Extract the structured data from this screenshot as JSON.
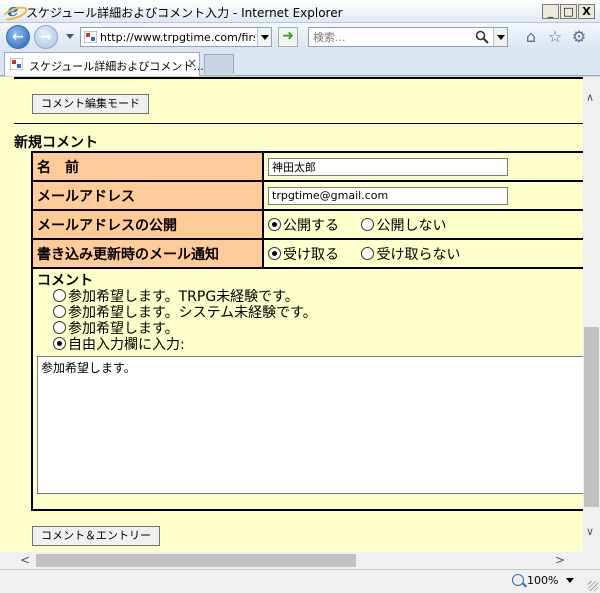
{
  "window": {
    "title": "スケジュール詳細およびコメント入力 - Internet Explorer",
    "minimize": "_",
    "maximize": "□",
    "close": "X"
  },
  "address_bar": {
    "url": "http://www.trpgtime.com/firs",
    "search_placeholder": "検索..."
  },
  "tab": {
    "label": "スケジュール詳細およびコメント...",
    "close": "×"
  },
  "page": {
    "edit_mode_button": "コメント編集モード",
    "section_title": "新規コメント",
    "name_label": "名　前",
    "name_value": "神田太郎",
    "email_label": "メールアドレス",
    "email_value": "trpgtime@gmail.com",
    "email_public_label": "メールアドレスの公開",
    "email_public_options": [
      "公開する",
      "公開しない"
    ],
    "email_public_selected": 0,
    "notify_label": "書き込み更新時のメール通知",
    "notify_options": [
      "受け取る",
      "受け取らない"
    ],
    "notify_selected": 0,
    "comment_label": "コメント",
    "comment_choices": [
      "参加希望します。TRPG未経験です。",
      "参加希望します。システム未経験です。",
      "参加希望します。",
      "自由入力欄に入力:"
    ],
    "comment_choice_selected": 3,
    "comment_text": "参加希望します。",
    "submit_button": "コメント＆エントリー"
  },
  "status_bar": {
    "zoom": "100%"
  },
  "colors": {
    "page_bg": "#ffffcc",
    "label_bg": "#ffcc99"
  }
}
